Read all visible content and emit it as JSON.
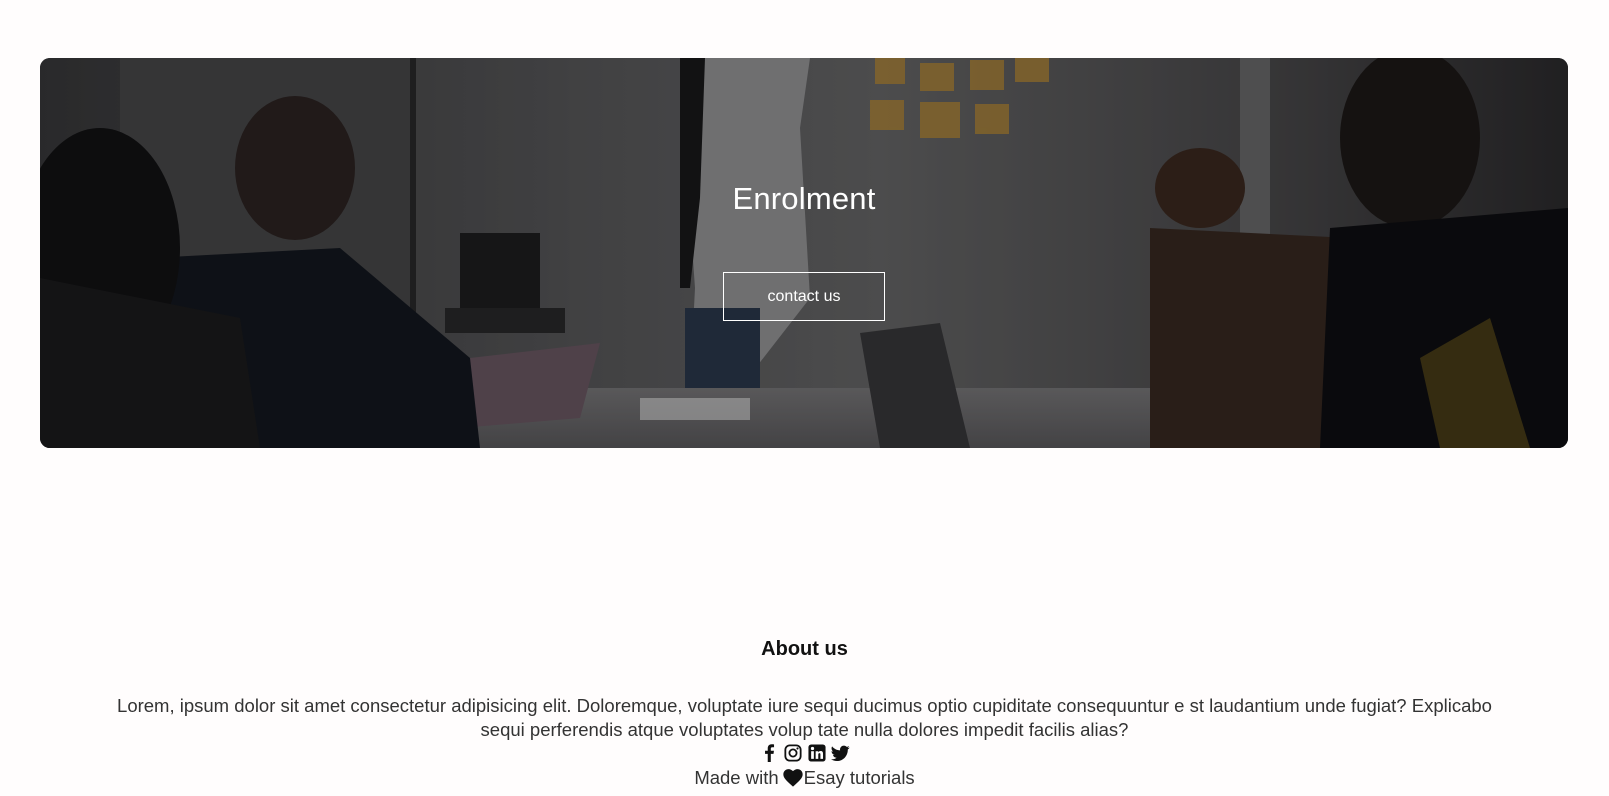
{
  "hero": {
    "title": "Enrolment",
    "button_label": "contact us"
  },
  "about": {
    "title": "About us",
    "text": "Lorem, ipsum dolor sit amet consectetur adipisicing elit. Doloremque, voluptate iure sequi ducimus optio cupiditate consequuntur e st laudantium unde fugiat? Explicabo sequi perferendis atque voluptates volup tate nulla dolores impedit facilis alias?",
    "social_icons": [
      "facebook-icon",
      "instagram-icon",
      "linkedin-icon",
      "twitter-icon"
    ],
    "made_with_prefix": "Made with",
    "made_with_suffix": "Esay tutorials"
  },
  "colors": {
    "page_background": "#fffdfd",
    "hero_text": "#ffffff",
    "body_text": "#333333",
    "sticky_note": "#e0a93a"
  }
}
